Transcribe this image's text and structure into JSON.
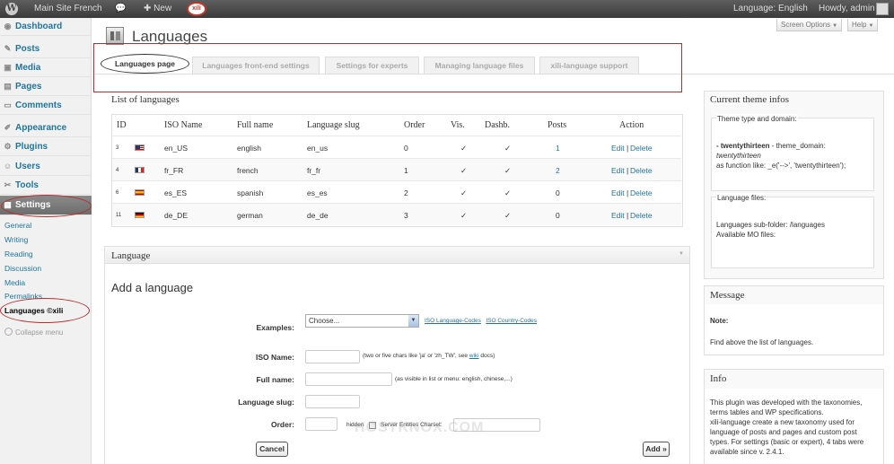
{
  "admin_bar": {
    "site_name": "Main Site French",
    "new_label": "New",
    "xili_logo_text": "xili",
    "language": "Language: English",
    "howdy": "Howdy, admin"
  },
  "sidebar": {
    "items": [
      {
        "label": "Dashboard",
        "icon": "dashboard-icon"
      },
      {
        "label": "Posts",
        "icon": "pin-icon"
      },
      {
        "label": "Media",
        "icon": "media-icon"
      },
      {
        "label": "Pages",
        "icon": "page-icon"
      },
      {
        "label": "Comments",
        "icon": "comment-icon"
      },
      {
        "label": "Appearance",
        "icon": "brush-icon"
      },
      {
        "label": "Plugins",
        "icon": "plug-icon"
      },
      {
        "label": "Users",
        "icon": "users-icon"
      },
      {
        "label": "Tools",
        "icon": "wrench-icon"
      },
      {
        "label": "Settings",
        "icon": "settings-icon"
      }
    ],
    "submenu": [
      "General",
      "Writing",
      "Reading",
      "Discussion",
      "Media",
      "Permalinks",
      "Languages ©xili"
    ],
    "collapse": "Collapse menu"
  },
  "header": {
    "title": "Languages",
    "screen_options": "Screen Options",
    "help": "Help"
  },
  "tabs": [
    "Languages page",
    "Languages front-end settings",
    "Settings for experts",
    "Managing language files",
    "xili-language support"
  ],
  "languages_table": {
    "title": "List of languages",
    "headers": [
      "ID",
      "ISO Name",
      "Full name",
      "Language slug",
      "Order",
      "Vis.",
      "Dashb.",
      "Posts",
      "Action"
    ],
    "rows": [
      {
        "id": "3",
        "iso": "en_US",
        "full": "english",
        "slug": "en_us",
        "order": "0",
        "vis": "✓",
        "dash": "✓",
        "posts": "1",
        "edit": "Edit",
        "sep": "|",
        "delete": "Delete"
      },
      {
        "id": "4",
        "iso": "fr_FR",
        "full": "french",
        "slug": "fr_fr",
        "order": "1",
        "vis": "✓",
        "dash": "✓",
        "posts": "2",
        "edit": "Edit",
        "sep": "|",
        "delete": "Delete"
      },
      {
        "id": "6",
        "iso": "es_ES",
        "full": "spanish",
        "slug": "es_es",
        "order": "2",
        "vis": "✓",
        "dash": "✓",
        "posts": "0",
        "edit": "Edit",
        "sep": "|",
        "delete": "Delete"
      },
      {
        "id": "11",
        "iso": "de_DE",
        "full": "german",
        "slug": "de_de",
        "order": "3",
        "vis": "✓",
        "dash": "✓",
        "posts": "0",
        "edit": "Edit",
        "sep": "|",
        "delete": "Delete"
      }
    ]
  },
  "language_box": {
    "title": "Language",
    "form_title": "Add a language",
    "examples_label": "Examples:",
    "examples_value": "Choose...",
    "iso_codes_link": "ISO Language-Codes",
    "country_codes_link": "ISO Country-Codes",
    "iso_label": "ISO Name:",
    "iso_hint_pre": "(two or five chars like 'ja' or 'zh_TW', see ",
    "iso_hint_link": "wiki",
    "iso_hint_post": " docs)",
    "full_label": "Full name:",
    "full_hint": "(as visible in list or menu: english, chinese,...)",
    "slug_label": "Language slug:",
    "order_label": "Order:",
    "hidden_label": "hidden",
    "server_label": "Server Entities Charset:",
    "cancel": "Cancel",
    "add": "Add »"
  },
  "theme_box": {
    "title": "Current theme infos",
    "type_label": "Theme type and domain:",
    "theme_name": "- twentythirteen",
    "domain_text": " - theme_domain:",
    "domain_value": "twentythirteen",
    "function_text": "as function like: _e('-->', 'twentythirteen');",
    "files_label": "Language files:",
    "subfolder": "Languages sub-folder: /languages",
    "mo_files": "Available MO files:"
  },
  "message_box": {
    "title": "Message",
    "note_label": "Note:",
    "note_text": "Find above the list of languages."
  },
  "info_box": {
    "title": "Info",
    "text_1": "This plugin was developed with the taxonomies,",
    "text_2": "terms tables and WP specifications.",
    "text_3": "xili-language create a new taxonomy used for",
    "text_4": "language of posts and pages and custom post",
    "text_5": "types. For settings (basic or expert), 4 tabs were",
    "text_6": "available since v. 2.4.1."
  },
  "watermark": "HOSTKNOX.COM",
  "colors": {
    "accent": "#21759b",
    "highlight": "#b03030",
    "adminbar": "#464646"
  }
}
